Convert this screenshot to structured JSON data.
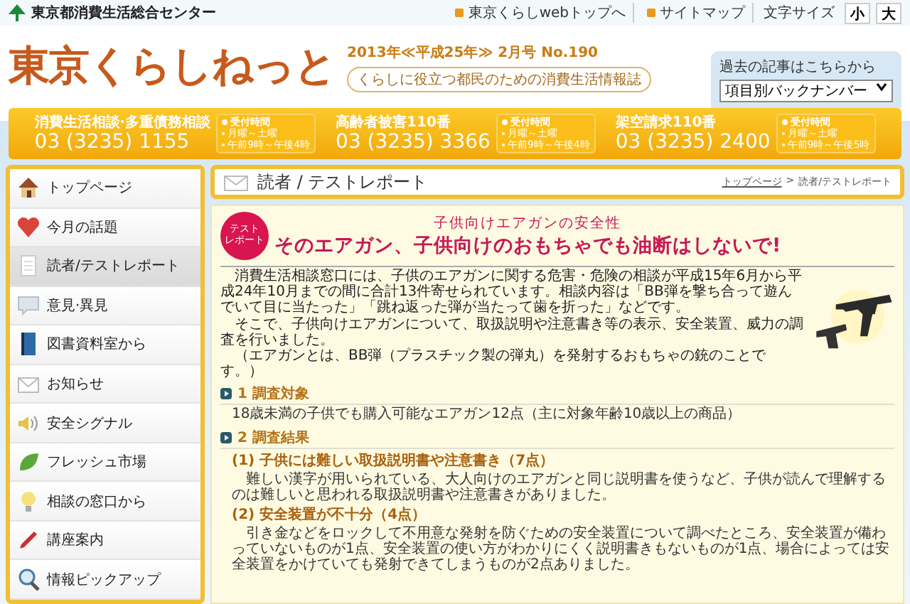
{
  "top_bar": {
    "org_name": "東京都消費生活総合センター",
    "links": [
      {
        "label": "東京くらしwebトップへ"
      },
      {
        "label": "サイトマップ"
      }
    ],
    "font_size_label": "文字サイズ",
    "font_size_buttons": [
      {
        "label": "小"
      },
      {
        "label": "大"
      }
    ]
  },
  "masthead": {
    "logo": "東京くらしねっと",
    "issue": "2013年≪平成25年≫ 2月号 No.190",
    "tagline": "くらしに役立つ都民のための消費生活情報誌",
    "backnumber_label": "過去の記事はこちらから",
    "backnumber_select": "項目別バックナンバー"
  },
  "hotlines": [
    {
      "name": "消費生活相談·多重債務相談",
      "number": "03 (3235) 1155",
      "hours_label": "受付時間",
      "days": "月曜～土曜",
      "time": "午前9時～午後4時"
    },
    {
      "name": "高齢者被害110番",
      "number": "03 (3235) 3366",
      "hours_label": "受付時間",
      "days": "月曜～土曜",
      "time": "午前9時～午後4時"
    },
    {
      "name": "架空請求110番",
      "number": "03 (3235) 2400",
      "hours_label": "受付時間",
      "days": "月曜～土曜",
      "time": "午前9時～午後5時"
    }
  ],
  "sidebar": {
    "items": [
      {
        "label": "トップページ",
        "kind": "home",
        "selected": false
      },
      {
        "label": "今月の話題",
        "kind": "heart",
        "selected": false
      },
      {
        "label": "読者/テストレポート",
        "kind": "document",
        "selected": true
      },
      {
        "label": "意見·異見",
        "kind": "speech",
        "selected": false
      },
      {
        "label": "図書資料室から",
        "kind": "book",
        "selected": false
      },
      {
        "label": "お知らせ",
        "kind": "mail",
        "selected": false
      },
      {
        "label": "安全シグナル",
        "kind": "speaker",
        "selected": false
      },
      {
        "label": "フレッシュ市場",
        "kind": "leaf",
        "selected": false
      },
      {
        "label": "相談の窓口から",
        "kind": "bulb",
        "selected": false
      },
      {
        "label": "講座案内",
        "kind": "pencil",
        "selected": false
      },
      {
        "label": "情報ピックアップ",
        "kind": "magnifier",
        "selected": false
      }
    ]
  },
  "page_header": {
    "title": "読者 / テストレポート",
    "breadcrumb_separator": ">",
    "breadcrumb": [
      {
        "label": "トップページ",
        "link": true
      },
      {
        "label": "読者/テストレポート",
        "link": false
      }
    ]
  },
  "article": {
    "badge_lines": [
      "テスト",
      "レポート"
    ],
    "subtitle": "子供向けエアガンの安全性",
    "title": "そのエアガン、子供向けのおもちゃでも油断はしないで!",
    "paragraphs": [
      "消費生活相談窓口には、子供のエアガンに関する危害・危険の相談が平成15年6月から平成24年10月までの間に合計13件寄せられています。相談内容は「BB弾を撃ち合って遊んでいて目に当たった」「跳ね返った弾が当たって歯を折った」などです。",
      "そこで、子供向けエアガンについて、取扱説明や注意書き等の表示、安全装置、威力の調査を行いました。",
      "（エアガンとは、BB弾（プラスチック製の弾丸）を発射するおもちゃの銃のことです。）"
    ],
    "sections": [
      {
        "number": "1",
        "heading": "調査対象",
        "body": "18歳未満の子供でも購入可能なエアガン12点（主に対象年齢10歳以上の商品）"
      },
      {
        "number": "2",
        "heading": "調査結果",
        "findings": [
          {
            "heading": "(1) 子供には難しい取扱説明書や注意書き（7点）",
            "text": "難しい漢字が用いられている、大人向けのエアガンと同じ説明書を使うなど、子供が読んで理解するのは難しいと思われる取扱説明書や注意書きがありました。"
          },
          {
            "heading": "(2) 安全装置が不十分（4点）",
            "text": "引き金などをロックして不用意な発射を防ぐための安全装置について調べたところ、安全装置が備わっていないものが1点、安全装置の使い方がわかりにくく説明書きもないものが1点、場合によっては安全装置をかけていても発射できてしまうものが2点ありました。"
          }
        ]
      }
    ]
  }
}
